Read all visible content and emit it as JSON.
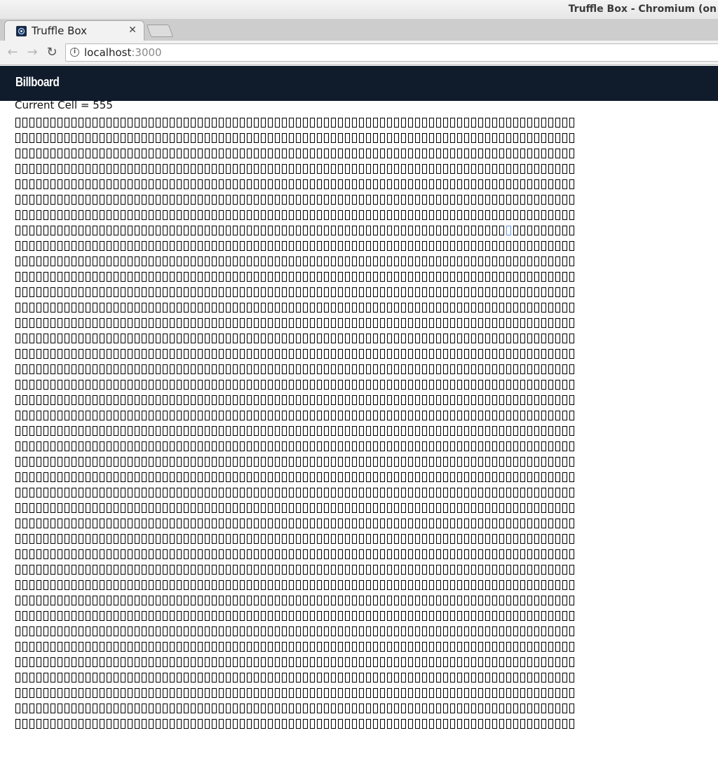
{
  "window": {
    "title": "Truffle Box - Chromium (on"
  },
  "tabs": [
    {
      "label": "Truffle Box",
      "close_icon": "close-icon",
      "favicon": "truffle-favicon-icon"
    }
  ],
  "toolbar": {
    "back_icon": "back-arrow-icon",
    "forward_icon": "forward-arrow-icon",
    "reload_icon": "reload-icon",
    "url_host": "localhost",
    "url_port": ":3000"
  },
  "app": {
    "brand": "Billboard",
    "current_cell_text": "Current Cell = 555",
    "grid": {
      "rows": 40,
      "columns": 80,
      "active_row": 7,
      "active_column": 70
    }
  },
  "colors": {
    "navbar": "#101c2c",
    "cell_border": "#000000",
    "active_cell_border": "#5b8fd6"
  }
}
